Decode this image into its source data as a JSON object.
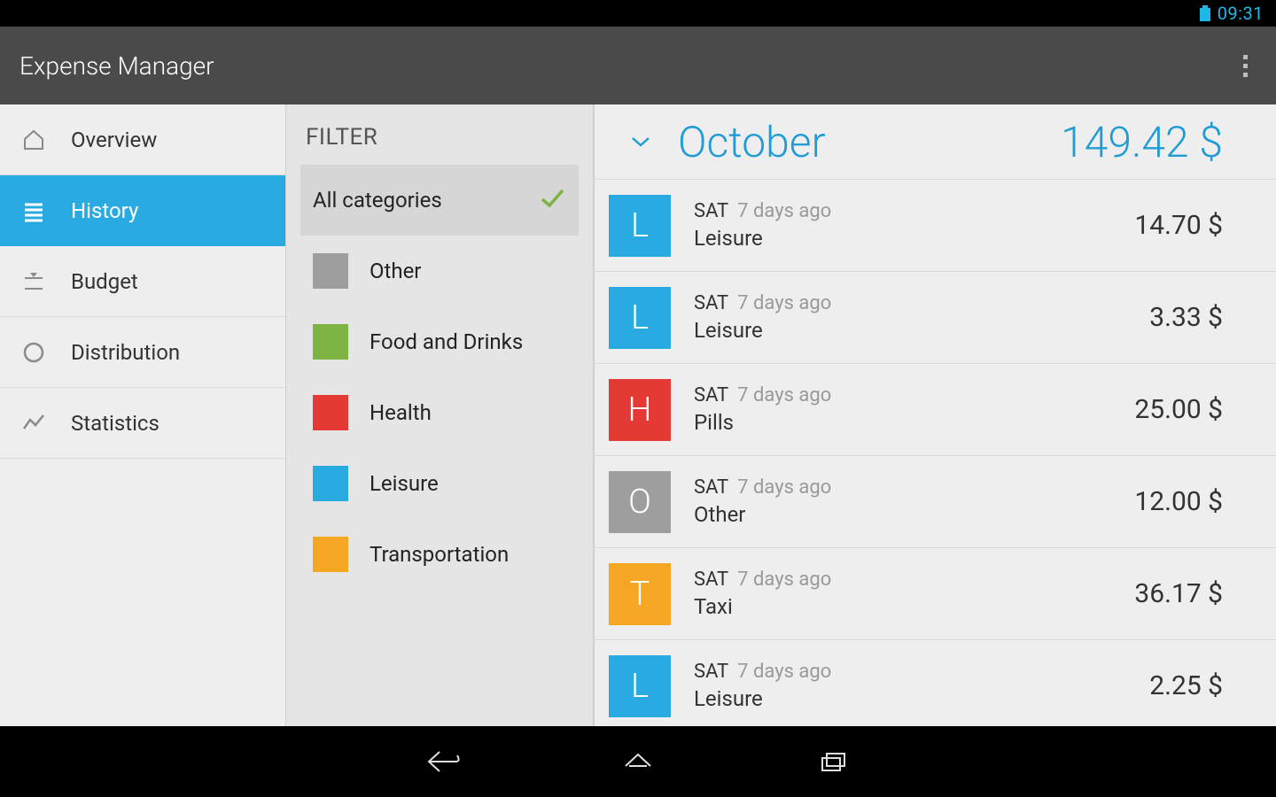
{
  "status": {
    "time": "09:31"
  },
  "action_bar": {
    "title": "Expense Manager"
  },
  "sidebar": {
    "items": [
      {
        "label": "Overview",
        "icon": "home",
        "active": false
      },
      {
        "label": "History",
        "icon": "list",
        "active": true
      },
      {
        "label": "Budget",
        "icon": "budget",
        "active": false
      },
      {
        "label": "Distribution",
        "icon": "circle",
        "active": false
      },
      {
        "label": "Statistics",
        "icon": "chart",
        "active": false
      }
    ]
  },
  "filter": {
    "title": "FILTER",
    "items": [
      {
        "label": "All categories",
        "color": null,
        "selected": true
      },
      {
        "label": "Other",
        "color": "#9e9e9e",
        "selected": false
      },
      {
        "label": "Food and Drinks",
        "color": "#7cb342",
        "selected": false
      },
      {
        "label": "Health",
        "color": "#e53935",
        "selected": false
      },
      {
        "label": "Leisure",
        "color": "#29aae1",
        "selected": false
      },
      {
        "label": "Transportation",
        "color": "#f5a623",
        "selected": false
      }
    ]
  },
  "month_header": {
    "month": "October",
    "total": "149.42 $"
  },
  "expenses": [
    {
      "badge": "L",
      "color": "#29aae1",
      "day": "SAT",
      "ago": "7 days ago",
      "cat": "Leisure",
      "amount": "14.70 $"
    },
    {
      "badge": "L",
      "color": "#29aae1",
      "day": "SAT",
      "ago": "7 days ago",
      "cat": "Leisure",
      "amount": "3.33 $"
    },
    {
      "badge": "H",
      "color": "#e53935",
      "day": "SAT",
      "ago": "7 days ago",
      "cat": "Pills",
      "amount": "25.00 $"
    },
    {
      "badge": "O",
      "color": "#9e9e9e",
      "day": "SAT",
      "ago": "7 days ago",
      "cat": "Other",
      "amount": "12.00 $"
    },
    {
      "badge": "T",
      "color": "#f5a623",
      "day": "SAT",
      "ago": "7 days ago",
      "cat": "Taxi",
      "amount": "36.17 $"
    },
    {
      "badge": "L",
      "color": "#29aae1",
      "day": "SAT",
      "ago": "7 days ago",
      "cat": "Leisure",
      "amount": "2.25 $"
    }
  ]
}
